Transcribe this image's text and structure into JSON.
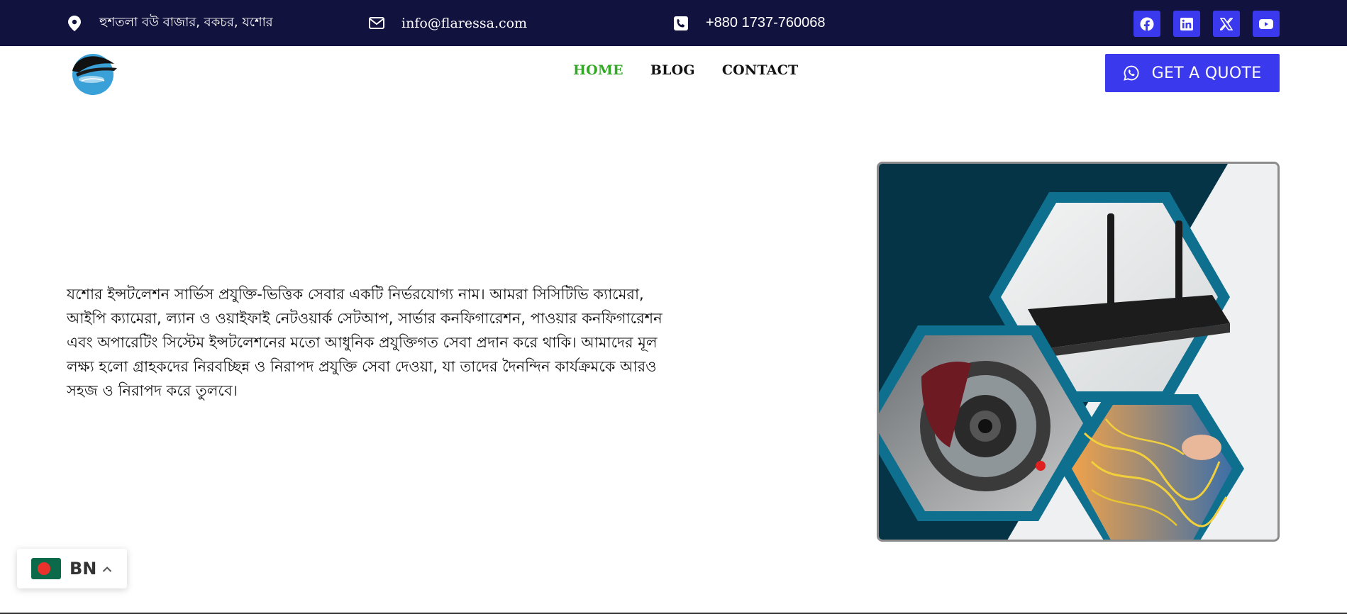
{
  "topbar": {
    "address": "হুশতলা বউ বাজার, বকচর, যশোর",
    "email": "info@flaressa.com",
    "phone": "+880 1737-760068",
    "socials": [
      "facebook-icon",
      "linkedin-icon",
      "x-icon",
      "youtube-icon"
    ]
  },
  "nav": {
    "items": [
      "HOME",
      "BLOG",
      "CONTACT"
    ],
    "active": "HOME",
    "quote_button": "GET A QUOTE"
  },
  "hero": {
    "text": "যশোর ইন্সটলেশন সার্ভিস প্রযুক্তি-ভিত্তিক সেবার একটি নির্ভরযোগ্য নাম। আমরা সিসিটিভি ক্যামেরা, আইপি ক্যামেরা, ল্যান ও ওয়াইফাই নেটওয়ার্ক সেটআপ, সার্ভার কনফিগারেশন, পাওয়ার কনফিগারেশন এবং অপারেটিং সিস্টেম ইন্সটলেশনের মতো আধুনিক প্রযুক্তিগত সেবা প্রদান করে থাকি। আমাদের মূল লক্ষ্য হলো গ্রাহকদের নিরবচ্ছিন্ন ও নিরাপদ প্রযুক্তি সেবা দেওয়া, যা তাদের দৈনন্দিন কার্যক্রমকে আরও সহজ ও নিরাপদ করে তুলবে।"
  },
  "language": {
    "code": "BN"
  },
  "colors": {
    "topbar_bg": "#12123f",
    "accent": "#3b39ee",
    "active_nav": "#33a827"
  }
}
